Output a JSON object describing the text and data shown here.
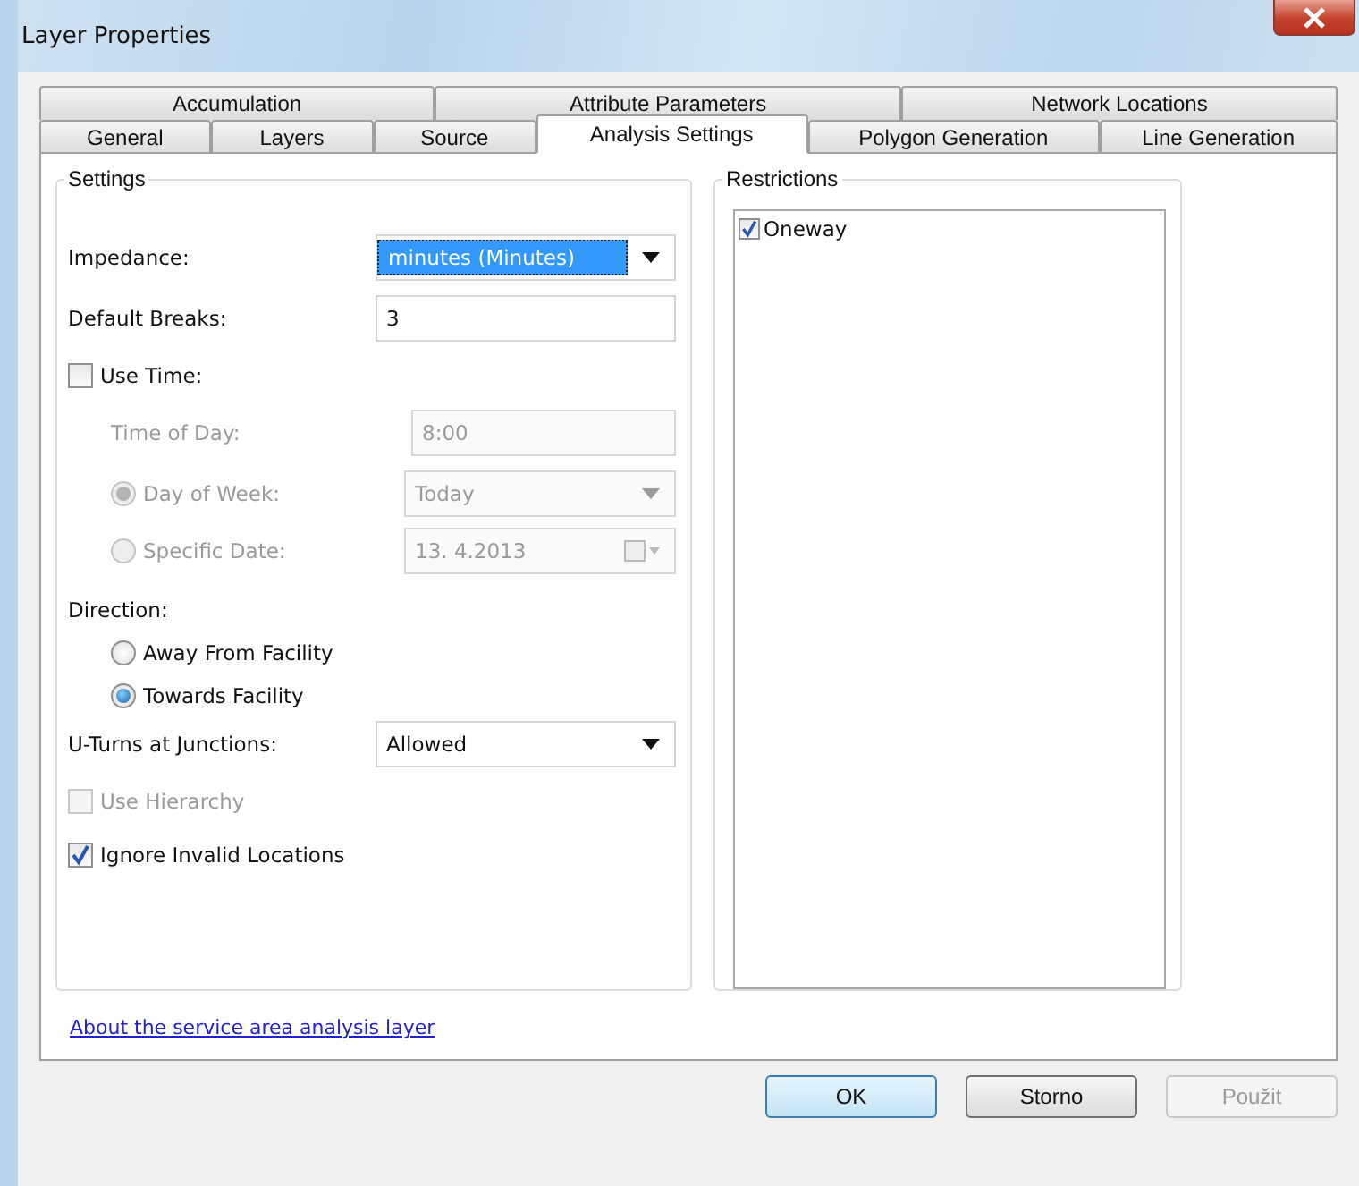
{
  "window": {
    "title": "Layer Properties"
  },
  "tab_rows": [
    [
      {
        "label": "Accumulation",
        "selected": false
      },
      {
        "label": "Attribute Parameters",
        "selected": false
      },
      {
        "label": "Network Locations",
        "selected": false
      }
    ],
    [
      {
        "label": "General",
        "selected": false
      },
      {
        "label": "Layers",
        "selected": false
      },
      {
        "label": "Source",
        "selected": false
      },
      {
        "label": "Analysis Settings",
        "selected": true
      },
      {
        "label": "Polygon Generation",
        "selected": false
      },
      {
        "label": "Line Generation",
        "selected": false
      }
    ]
  ],
  "settings": {
    "title": "Settings",
    "rows": [
      {
        "kind": "field",
        "label": "Impedance:",
        "disabled": false,
        "control": {
          "kind": "dropdown",
          "value": "minutes (Minutes)",
          "highlighted": true
        }
      },
      {
        "kind": "field",
        "label": "Default Breaks:",
        "disabled": false,
        "control": {
          "kind": "text",
          "value": "3"
        }
      },
      {
        "kind": "checkbox",
        "label": "Use Time:",
        "checked": false,
        "disabled": false,
        "children": [
          {
            "kind": "field",
            "label": "Time of Day:",
            "disabled": true,
            "control": {
              "kind": "text",
              "value": "8:00"
            }
          },
          {
            "kind": "radio",
            "label": "Day of Week:",
            "selected": true,
            "disabled": true,
            "control": {
              "kind": "dropdown",
              "value": "Today",
              "highlighted": false
            }
          },
          {
            "kind": "radio",
            "label": "Specific Date:",
            "selected": false,
            "disabled": true,
            "control": {
              "kind": "date",
              "value": "13. 4.2013"
            }
          }
        ]
      },
      {
        "kind": "heading",
        "label": "Direction:",
        "disabled": false,
        "children": [
          {
            "kind": "radio",
            "label": "Away From Facility",
            "selected": false,
            "disabled": false
          },
          {
            "kind": "radio",
            "label": "Towards Facility",
            "selected": true,
            "disabled": false
          }
        ]
      },
      {
        "kind": "field",
        "label": "U-Turns at Junctions:",
        "disabled": false,
        "control": {
          "kind": "dropdown",
          "value": "Allowed",
          "highlighted": false
        }
      },
      {
        "kind": "checkbox",
        "label": "Use Hierarchy",
        "checked": false,
        "disabled": true
      },
      {
        "kind": "checkbox",
        "label": "Ignore Invalid Locations",
        "checked": true,
        "disabled": false
      }
    ]
  },
  "restrictions": {
    "title": "Restrictions",
    "items": [
      {
        "label": "Oneway",
        "checked": true
      }
    ]
  },
  "link": "About the service area analysis layer",
  "buttons": [
    {
      "label": "OK",
      "default": true,
      "disabled": false
    },
    {
      "label": "Storno",
      "default": false,
      "disabled": false
    },
    {
      "label": "Použit",
      "default": false,
      "disabled": true
    }
  ]
}
